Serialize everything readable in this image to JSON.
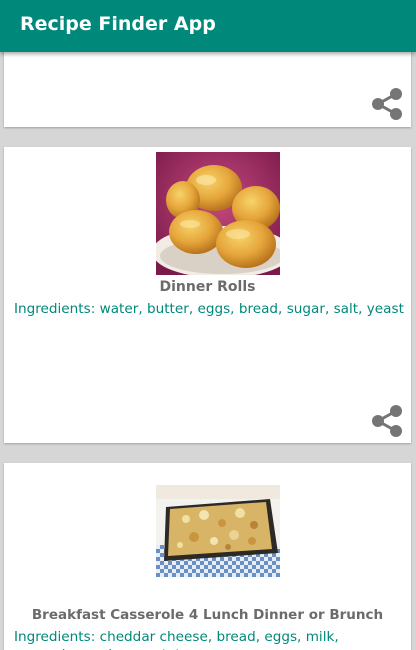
{
  "app": {
    "title": "Recipe Finder App",
    "accent_color": "#00897b"
  },
  "recipes": [
    {
      "name": "",
      "ingredients": "",
      "share_icon": "share-icon"
    },
    {
      "name": "Dinner Rolls",
      "ingredients": "Ingredients: water, butter, eggs, bread, sugar, salt, yeast",
      "image": "dinner-rolls-photo",
      "share_icon": "share-icon"
    },
    {
      "name": "Breakfast Casserole 4 Lunch Dinner or Brunch",
      "ingredients": "Ingredients: cheddar cheese, bread, eggs, milk, seasoning, onions, potato, sausage",
      "image": "casserole-photo"
    }
  ]
}
